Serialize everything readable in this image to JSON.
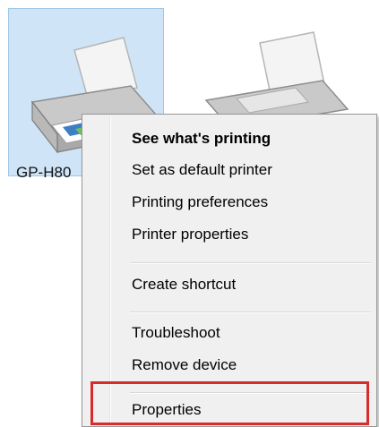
{
  "printers": [
    {
      "label": "GP-H80",
      "selected": true
    },
    {
      "label": "",
      "selected": false
    }
  ],
  "context_menu": {
    "items": [
      {
        "label": "See what's printing",
        "bold": true
      },
      {
        "label": "Set as default printer"
      },
      {
        "label": "Printing preferences"
      },
      {
        "label": "Printer properties"
      },
      {
        "label": "Create shortcut"
      },
      {
        "label": "Troubleshoot"
      },
      {
        "label": "Remove device"
      },
      {
        "label": "Properties",
        "highlighted": true
      }
    ]
  },
  "colors": {
    "selection_fill": "#cfe5f7",
    "selection_border": "#9fc7e8",
    "menu_background": "#f0f0f0",
    "highlight_border": "#d92b2b"
  },
  "icons": [
    "printer-icon"
  ]
}
